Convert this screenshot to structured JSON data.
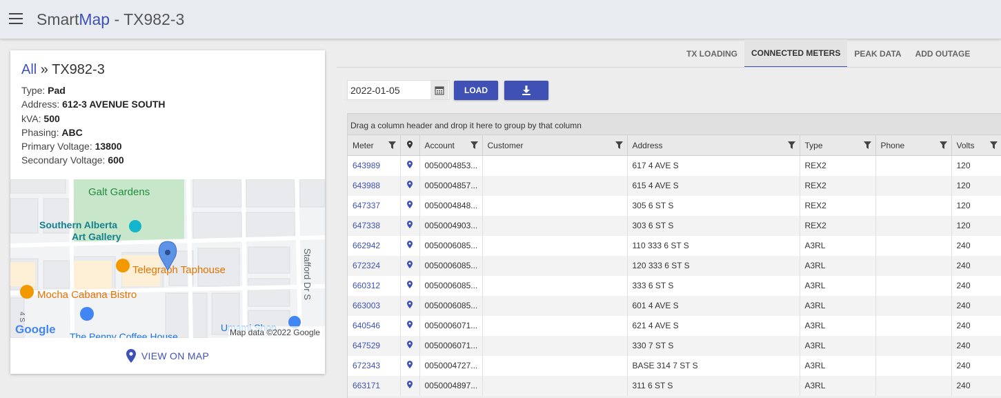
{
  "header": {
    "title_part1": "Smart",
    "title_part2": "Map",
    "title_part3": " - TX982-3",
    "menu_icon": "hamburger-menu-icon"
  },
  "transformer": {
    "crumb_all": "All",
    "crumb_sep": " » ",
    "crumb_name": "TX982-3",
    "properties": [
      {
        "label": "Type: ",
        "value": "Pad"
      },
      {
        "label": "Address: ",
        "value": "612-3 AVENUE SOUTH"
      },
      {
        "label": "kVA: ",
        "value": "500"
      },
      {
        "label": "Phasing: ",
        "value": "ABC"
      },
      {
        "label": "Primary Voltage: ",
        "value": "13800"
      },
      {
        "label": "Secondary Voltage: ",
        "value": "600"
      }
    ],
    "map": {
      "labels": {
        "galt_gardens": "Galt Gardens",
        "gallery_1": "Southern Alberta",
        "gallery_2": "Art Gallery",
        "telegraph": "Telegraph Taphouse",
        "mocha": "Mocha Cabana Bistro",
        "stafford": "Stafford Dr S",
        "umami": "Umami Shop",
        "penny": "The Penny Coffee House",
        "four_s": "4 S",
        "attribution": "Map data ©2022 Google",
        "google": "Google"
      }
    },
    "view_on_map": "VIEW ON MAP"
  },
  "tabs": [
    {
      "label": "TX LOADING",
      "active": false
    },
    {
      "label": "CONNECTED METERS",
      "active": true
    },
    {
      "label": "PEAK DATA",
      "active": false
    },
    {
      "label": "ADD OUTAGE",
      "active": false
    }
  ],
  "toolbar": {
    "date_value": "2022-01-05",
    "load_label": "LOAD",
    "download_icon": "download-icon",
    "calendar_icon": "calendar-icon"
  },
  "grid": {
    "group_hint": "Drag a column header and drop it here to group by that column",
    "columns": [
      "Meter",
      "",
      "Account",
      "Customer",
      "Address",
      "Type",
      "Phone",
      "Volts"
    ],
    "rows": [
      {
        "meter": "643989",
        "account": "0050004853...",
        "customer": "",
        "address": "617 4 AVE S",
        "type": "REX2",
        "phone": "",
        "volts": "120"
      },
      {
        "meter": "643988",
        "account": "0050004857...",
        "customer": "",
        "address": "615 4 AVE S",
        "type": "REX2",
        "phone": "",
        "volts": "120"
      },
      {
        "meter": "647337",
        "account": "0050004848...",
        "customer": "",
        "address": "305 6 ST S",
        "type": "REX2",
        "phone": "",
        "volts": "120"
      },
      {
        "meter": "647338",
        "account": "0050004903...",
        "customer": "",
        "address": "303 6 ST S",
        "type": "REX2",
        "phone": "",
        "volts": "120"
      },
      {
        "meter": "662942",
        "account": "0050006085...",
        "customer": "",
        "address": "110 333 6 ST S",
        "type": "A3RL",
        "phone": "",
        "volts": "240"
      },
      {
        "meter": "672324",
        "account": "0050006085...",
        "customer": "",
        "address": "120 333 6 ST S",
        "type": "A3RL",
        "phone": "",
        "volts": "240"
      },
      {
        "meter": "660312",
        "account": "0050006085...",
        "customer": "",
        "address": "333 6 ST S",
        "type": "A3RL",
        "phone": "",
        "volts": "240"
      },
      {
        "meter": "663003",
        "account": "0050006085...",
        "customer": "",
        "address": "601 4 AVE S",
        "type": "A3RL",
        "phone": "",
        "volts": "240"
      },
      {
        "meter": "640546",
        "account": "0050006071...",
        "customer": "",
        "address": "621 4 AVE S",
        "type": "A3RL",
        "phone": "",
        "volts": "240"
      },
      {
        "meter": "647529",
        "account": "0050006071...",
        "customer": "",
        "address": "330 7 ST S",
        "type": "A3RL",
        "phone": "",
        "volts": "240"
      },
      {
        "meter": "672343",
        "account": "0050004727...",
        "customer": "",
        "address": "BASE 314 7 ST S",
        "type": "A3RL",
        "phone": "",
        "volts": "240"
      },
      {
        "meter": "663171",
        "account": "0050004897...",
        "customer": "",
        "address": "311 6 ST S",
        "type": "A3RL",
        "phone": "",
        "volts": "240"
      }
    ]
  },
  "colors": {
    "accent": "#3f51b5",
    "header_bg": "#e8ecf1",
    "page_bg": "#ededed"
  }
}
